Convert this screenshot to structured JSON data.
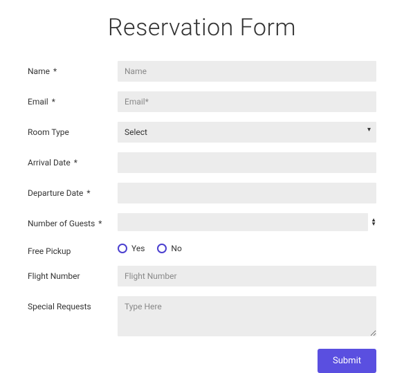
{
  "title": "Reservation Form",
  "labels": {
    "name": "Name",
    "email": "Email",
    "room_type": "Room Type",
    "arrival_date": "Arrival Date",
    "departure_date": "Departure Date",
    "guests": "Number of Guests",
    "free_pickup": "Free Pickup",
    "flight_number": "Flight Number",
    "special_requests": "Special Requests",
    "required": "*"
  },
  "placeholders": {
    "name": "Name",
    "email": "Email*",
    "flight_number": "Flight Number",
    "special_requests": "Type Here"
  },
  "room_type_selected": "Select",
  "pickup_options": {
    "yes": "Yes",
    "no": "No"
  },
  "submit_label": "Submit"
}
